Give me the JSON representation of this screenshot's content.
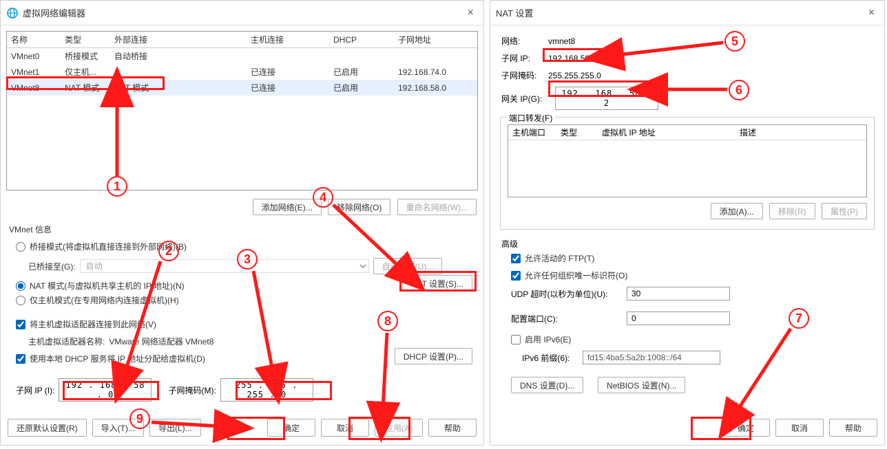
{
  "left_dialog": {
    "title": "虚拟网络编辑器",
    "columns": {
      "name": "名称",
      "type": "类型",
      "external": "外部连接",
      "host": "主机连接",
      "dhcp": "DHCP",
      "subnet": "子网地址"
    },
    "rows": [
      {
        "name": "VMnet0",
        "type": "桥接模式",
        "external": "自动桥接",
        "host": "",
        "dhcp": "",
        "subnet": ""
      },
      {
        "name": "VMnet1",
        "type": "仅主机...",
        "external": "-",
        "host": "已连接",
        "dhcp": "已启用",
        "subnet": "192.168.74.0"
      },
      {
        "name": "VMnet8",
        "type": "NAT 模式",
        "external": "NAT 模式",
        "host": "已连接",
        "dhcp": "已启用",
        "subnet": "192.168.58.0"
      }
    ],
    "add_network_btn": "添加网络(E)...",
    "remove_network_btn": "移除网络(O)",
    "rename_network_btn": "重命名网络(W)...",
    "vmnet_info_label": "VMnet 信息",
    "radio_bridged": "桥接模式(将虚拟机直接连接到外部网络)(B)",
    "bridged_to_label": "已桥接至(G):",
    "bridged_to_value": "自动",
    "auto_settings_btn": "自动设置(U)...",
    "radio_nat": "NAT 模式(与虚拟机共享主机的 IP 地址)(N)",
    "nat_settings_btn": "NAT 设置(S)...",
    "radio_hostonly": "仅主机模式(在专用网络内连接虚拟机)(H)",
    "check_host_adapter": "将主机虚拟适配器连接到此网络(V)",
    "host_adapter_name_label": "主机虚拟适配器名称:",
    "host_adapter_name_value": "VMware 网络适配器 VMnet8",
    "check_dhcp": "使用本地 DHCP 服务将 IP 地址分配给虚拟机(D)",
    "dhcp_settings_btn": "DHCP 设置(P)...",
    "subnet_ip_label": "子网 IP (I):",
    "subnet_ip_value": "192 . 168 . 58  .  0",
    "subnet_mask_label": "子网掩码(M):",
    "subnet_mask_value": "255 . 255 . 255 .  0",
    "restore_btn": "还原默认设置(R)",
    "import_btn": "导入(T)...",
    "export_btn": "导出(L)...",
    "ok_btn": "确定",
    "cancel_btn": "取消",
    "apply_btn": "应用(A)",
    "help_btn": "帮助"
  },
  "right_dialog": {
    "title": "NAT 设置",
    "network_label": "网络:",
    "network_value": "vmnet8",
    "subnet_ip_label": "子网 IP:",
    "subnet_ip_value": "192.168.58.0",
    "subnet_mask_label": "子网掩码:",
    "subnet_mask_value": "255.255.255.0",
    "gateway_label": "网关 IP(G):",
    "gateway_value": "192 . 168 . 58  .  2",
    "port_forward_legend": "端口转发(F)",
    "port_columns": {
      "hostport": "主机端口",
      "type": "类型",
      "vmip": "虚拟机 IP 地址",
      "desc": "描述"
    },
    "add_btn": "添加(A)...",
    "remove_btn": "移除(R)",
    "properties_btn": "属性(P)",
    "advanced_label": "高级",
    "check_ftp": "允许活动的 FTP(T)",
    "check_oui": "允许任何组织唯一标识符(O)",
    "udp_timeout_label": "UDP 超时(以秒为单位)(U):",
    "udp_timeout_value": "30",
    "config_port_label": "配置端口(C):",
    "config_port_value": "0",
    "check_ipv6": "启用 IPv6(E)",
    "ipv6_prefix_label": "IPv6 前缀(6):",
    "ipv6_prefix_value": "fd15:4ba5:5a2b:1008::/64",
    "dns_btn": "DNS 设置(D)...",
    "netbios_btn": "NetBIOS 设置(N)...",
    "ok_btn": "确定",
    "cancel_btn": "取消",
    "help_btn": "帮助"
  },
  "annotations": {
    "n1": "1",
    "n2": "2",
    "n3": "3",
    "n4": "4",
    "n5": "5",
    "n6": "6",
    "n7": "7",
    "n8": "8",
    "n9": "9"
  }
}
